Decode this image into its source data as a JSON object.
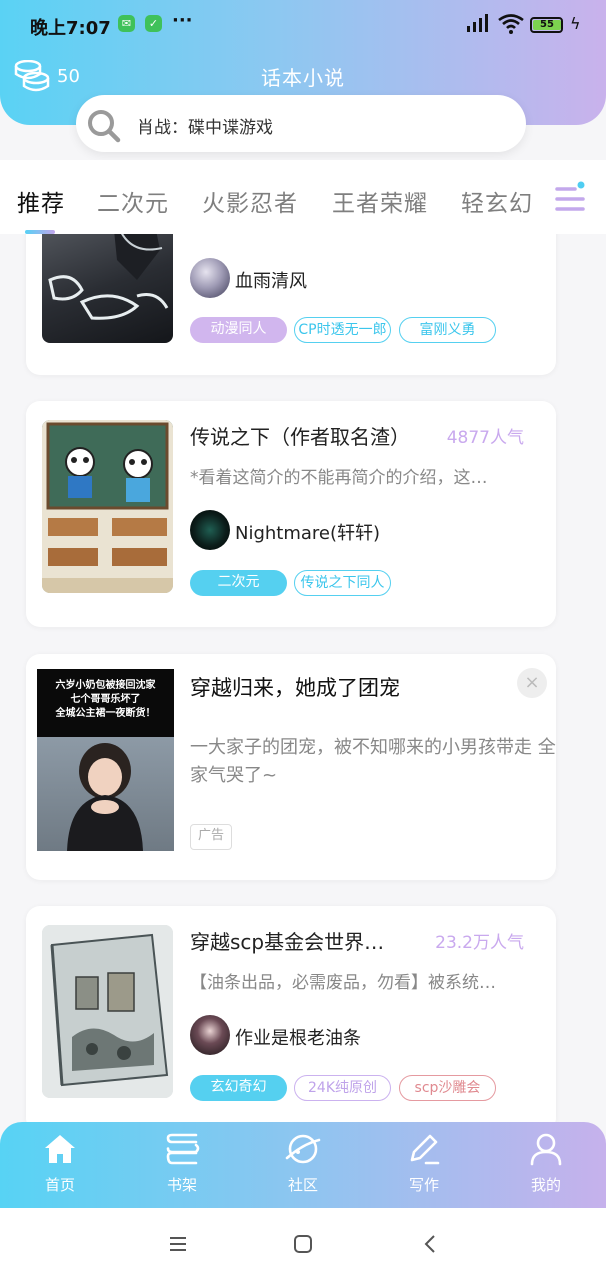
{
  "status_bar": {
    "time": "晚上7:07",
    "more": "···",
    "battery": "55"
  },
  "header": {
    "coins": "50",
    "title": "话本小说"
  },
  "search": {
    "placeholder": "肖战：碟中谍游戏"
  },
  "tabs": [
    "推荐",
    "二次元",
    "火影忍者",
    "王者荣耀",
    "轻玄幻"
  ],
  "cards": [
    {
      "author": "血雨清风",
      "tags": [
        "动漫同人",
        "CP时透无一郎",
        "富刚义勇"
      ]
    },
    {
      "title": "传说之下（作者取名渣）",
      "popularity": "4877人气",
      "desc": "*看着这简介的不能再简介的介绍，这…",
      "author": "Nightmare(轩轩)",
      "tags": [
        "二次元",
        "传说之下同人"
      ]
    },
    {
      "title": "穿越scp基金会世界…",
      "popularity": "23.2万人气",
      "desc": "【油条出品，必需废品，勿看】被系统…",
      "author": "作业是根老油条",
      "tags": [
        "玄幻奇幻",
        "24K纯原创",
        "scp沙雕会"
      ]
    }
  ],
  "ad": {
    "title": "穿越归来，她成了团宠",
    "desc": "一大家子的团宠，被不知哪来的小男孩带走 全家气哭了~",
    "label": "广告",
    "close": "×",
    "banner_lines": [
      "六岁小奶包被接回沈家",
      "七个哥哥乐坏了",
      "全城公主裙一夜断货！"
    ]
  },
  "bottom_nav": [
    "首页",
    "书架",
    "社区",
    "写作",
    "我的"
  ],
  "colors": {
    "accent_blue": "#55d0f0",
    "accent_purple": "#c9a9ee"
  }
}
